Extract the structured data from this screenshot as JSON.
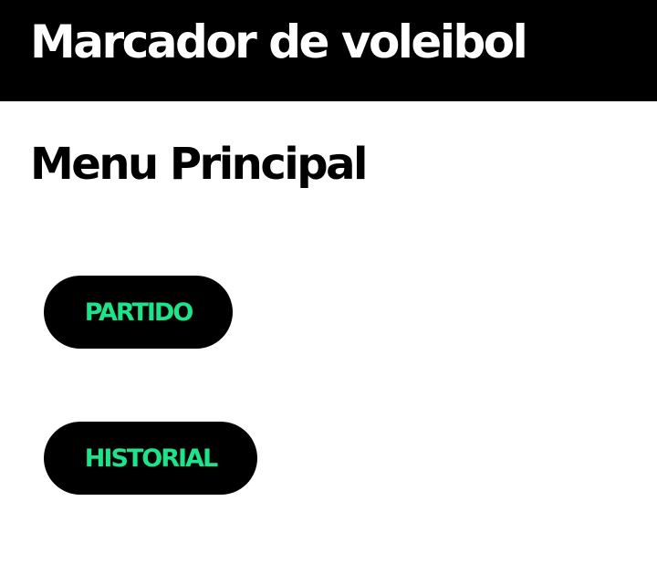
{
  "app_bar": {
    "title": "Marcador de voleibol"
  },
  "main": {
    "heading": "Menu Principal",
    "buttons": [
      {
        "label": "PARTIDO"
      },
      {
        "label": "HISTORIAL"
      }
    ]
  },
  "colors": {
    "app_bar_background": "#000000",
    "title_text": "#ffffff",
    "button_background": "#000000",
    "button_text": "#1de38a",
    "page_background": "#ffffff"
  }
}
